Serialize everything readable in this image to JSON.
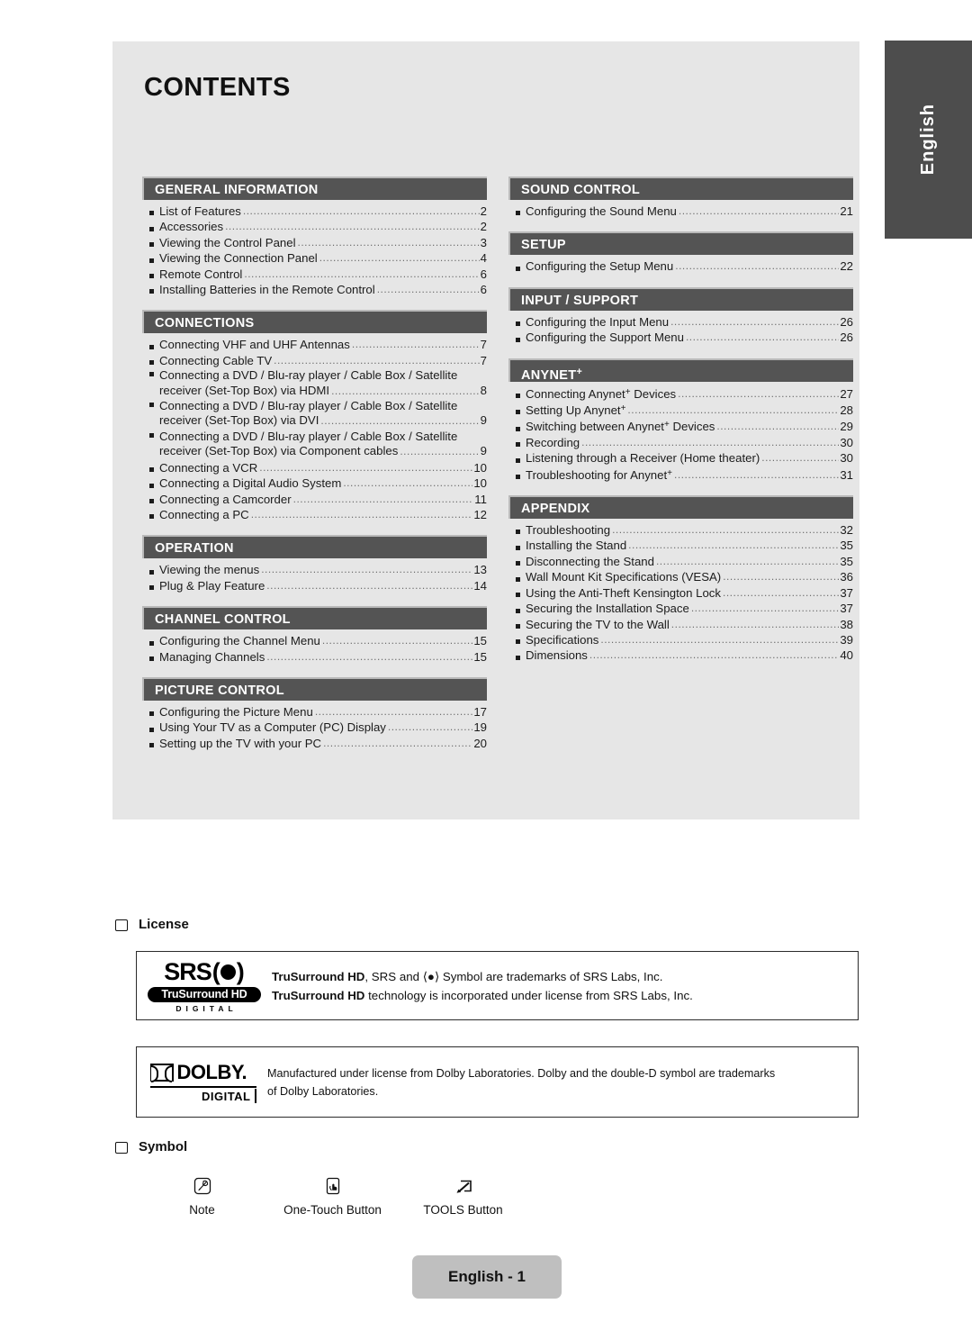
{
  "language_tab": {
    "label": "English"
  },
  "contents": {
    "title": "CONTENTS",
    "left_sections": [
      {
        "heading": "GENERAL INFORMATION",
        "entries": [
          {
            "text": "List of Features",
            "page": "2"
          },
          {
            "text": "Accessories",
            "page": "2"
          },
          {
            "text": "Viewing the Control Panel",
            "page": "3"
          },
          {
            "text": "Viewing the Connection Panel",
            "page": "4"
          },
          {
            "text": "Remote Control",
            "page": "6"
          },
          {
            "text": "Installing Batteries in the Remote Control",
            "page": "6"
          }
        ]
      },
      {
        "heading": "CONNECTIONS",
        "entries": [
          {
            "text": "Connecting VHF and UHF Antennas",
            "page": "7"
          },
          {
            "text": "Connecting Cable TV",
            "page": "7"
          },
          {
            "line1": "Connecting a DVD / Blu-ray player / Cable Box / Satellite",
            "line2": "receiver (Set-Top Box) via HDMI",
            "page": "8"
          },
          {
            "line1": "Connecting a DVD / Blu-ray player / Cable Box / Satellite",
            "line2": "receiver (Set-Top Box) via DVI",
            "page": "9"
          },
          {
            "line1": "Connecting a DVD / Blu-ray player / Cable Box / Satellite",
            "line2": "receiver (Set-Top Box) via Component cables",
            "page": "9"
          },
          {
            "text": "Connecting a VCR",
            "page": "10"
          },
          {
            "text": "Connecting a Digital Audio System",
            "page": "10"
          },
          {
            "text": "Connecting a Camcorder",
            "page": "11"
          },
          {
            "text": "Connecting a PC",
            "page": "12"
          }
        ]
      },
      {
        "heading": "OPERATION",
        "entries": [
          {
            "text": "Viewing the menus",
            "page": "13"
          },
          {
            "text": "Plug & Play Feature",
            "page": "14"
          }
        ]
      },
      {
        "heading": "CHANNEL CONTROL",
        "entries": [
          {
            "text": "Configuring the Channel Menu",
            "page": "15"
          },
          {
            "text": "Managing Channels",
            "page": "15"
          }
        ]
      },
      {
        "heading": "PICTURE CONTROL",
        "entries": [
          {
            "text": "Configuring the Picture Menu",
            "page": "17"
          },
          {
            "text": "Using Your TV as a Computer (PC) Display",
            "page": "19"
          },
          {
            "text": "Setting up the TV with your PC",
            "page": "20"
          }
        ]
      }
    ],
    "right_sections": [
      {
        "heading": "SOUND CONTROL",
        "entries": [
          {
            "text": "Configuring the Sound Menu",
            "page": "21"
          }
        ]
      },
      {
        "heading": "SETUP",
        "entries": [
          {
            "text": "Configuring the Setup Menu",
            "page": "22"
          }
        ]
      },
      {
        "heading": "INPUT / SUPPORT",
        "entries": [
          {
            "text": "Configuring the Input Menu",
            "page": "26"
          },
          {
            "text": "Configuring the Support Menu",
            "page": "26"
          }
        ]
      },
      {
        "heading": "ANYNET",
        "heading_sup": "+",
        "entries": [
          {
            "text": "Connecting Anynet",
            "sup": "+",
            "text_after": " Devices",
            "page": "27"
          },
          {
            "text": "Setting Up Anynet",
            "sup": "+",
            "text_after": "",
            "page": "28"
          },
          {
            "text": "Switching between Anynet",
            "sup": "+",
            "text_after": " Devices",
            "page": "29"
          },
          {
            "text": "Recording",
            "page": "30"
          },
          {
            "text": "Listening through a Receiver (Home theater)",
            "page": "30"
          },
          {
            "text": "Troubleshooting for Anynet",
            "sup": "+",
            "text_after": "",
            "page": "31"
          }
        ]
      },
      {
        "heading": "APPENDIX",
        "entries": [
          {
            "text": "Troubleshooting",
            "page": "32"
          },
          {
            "text": "Installing the Stand",
            "page": "35"
          },
          {
            "text": "Disconnecting the Stand",
            "page": "35"
          },
          {
            "text": "Wall Mount Kit Specifications (VESA)",
            "page": "36"
          },
          {
            "text": "Using the Anti-Theft Kensington Lock",
            "page": "37"
          },
          {
            "text": "Securing the Installation Space",
            "page": "37"
          },
          {
            "text": "Securing the TV to the Wall",
            "page": "38"
          },
          {
            "text": "Specifications",
            "page": "39"
          },
          {
            "text": "Dimensions",
            "page": "40"
          }
        ]
      }
    ]
  },
  "license": {
    "heading": "License",
    "srs": {
      "logo_word": "SRS",
      "logo_band": "TruSurround HD",
      "logo_sub": "DIGITAL",
      "line1_bold": "TruSurround HD",
      "line1_rest": ", SRS and ⟨●⟩ Symbol are trademarks of SRS Labs, Inc.",
      "line2_bold": "TruSurround HD",
      "line2_rest": " technology is incorporated under license from SRS Labs, Inc."
    },
    "dolby": {
      "logo_word": "DOLBY.",
      "logo_sub": "DIGITAL",
      "line1": "Manufactured under license from Dolby Laboratories. Dolby and the double-D symbol are trademarks",
      "line2": "of Dolby Laboratories."
    }
  },
  "symbol": {
    "heading": "Symbol",
    "items": [
      {
        "icon": "note-icon",
        "caption": "Note"
      },
      {
        "icon": "one-touch-button-icon",
        "caption": "One-Touch Button"
      },
      {
        "icon": "tools-button-icon",
        "caption": "TOOLS Button"
      }
    ]
  },
  "footer": {
    "label": "English - 1"
  },
  "colors": {
    "panel_bg": "#e6e6e6",
    "section_header_bg": "#545454",
    "tab_bg": "#4d4d4d",
    "footer_bg": "#bfbfbf"
  }
}
